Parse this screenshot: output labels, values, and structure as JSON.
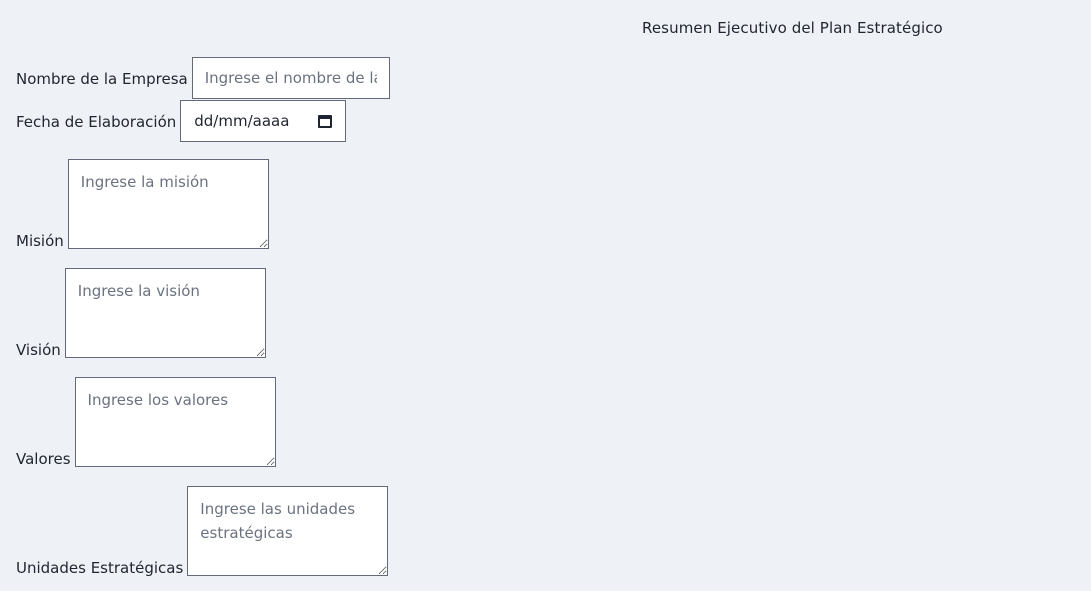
{
  "header": {
    "title": "Resumen Ejecutivo del Plan Estratégico"
  },
  "form": {
    "empresa": {
      "label": "Nombre de la Empresa",
      "placeholder": "Ingrese el nombre de la empresa",
      "value": ""
    },
    "fecha": {
      "label": "Fecha de Elaboración",
      "display": "dd/mm/aaaa",
      "icon": "calendar-icon"
    },
    "mision": {
      "label": "Misión",
      "placeholder": "Ingrese la misión"
    },
    "vision": {
      "label": "Visión",
      "placeholder": "Ingrese la visión"
    },
    "valores": {
      "label": "Valores",
      "placeholder": "Ingrese los valores"
    },
    "unidades": {
      "label": "Unidades Estratégicas",
      "placeholder": "Ingrese las unidades estratégicas"
    }
  }
}
